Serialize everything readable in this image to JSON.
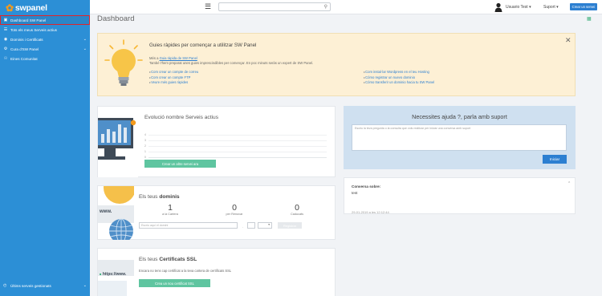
{
  "brand": {
    "name": "swpanel"
  },
  "sidebar": {
    "items": [
      {
        "label": "Dashboard SW Panel",
        "icon": "monitor-icon",
        "active": true,
        "chevron": false
      },
      {
        "label": "Tots els meus Serveis actius",
        "icon": "list-icon",
        "active": false,
        "chevron": false
      },
      {
        "label": "Dominis i Certificats",
        "icon": "globe-icon",
        "active": false,
        "chevron": true
      },
      {
        "label": "Cura d'SW Panel",
        "icon": "gear-icon",
        "active": false,
        "chevron": true
      },
      {
        "label": "Eines Comunitat",
        "icon": "users-icon",
        "active": false,
        "chevron": false
      }
    ],
    "footer_label": "Últims serveis gestionats"
  },
  "topbar": {
    "menu_icon": "hamburger-icon",
    "search_placeholder": "",
    "user_label": "Usuario Test",
    "support_label": "Suport",
    "new_button": "Crear un servei"
  },
  "page": {
    "title": "Dashboard"
  },
  "guide": {
    "title": "Guies ràpides per començar a utilitzar SW Panel",
    "line1_prefix": "Més a",
    "line1_link": "Guia ràpida de SW Panel",
    "line2": "També t'hem preparat unes guies imprescindibles per començar. En poc minuts seràs un expert de SW Panel.",
    "links_left": [
      "Com crear un compte de correu",
      "Com crear un compte FTP",
      "Veure més guies ràpides"
    ],
    "links_right": [
      "Com instal·lar Wordpress en el teu Hosting",
      "Cómo registrar un nuevo dominio",
      "Cómo transferir un dominio hacia tu SW Panel"
    ]
  },
  "services": {
    "title": "Evolució nombre Serveis actius",
    "chart_ticks": [
      "4",
      "3",
      "2",
      "1",
      "0"
    ],
    "button": "Crear un altre servei ara"
  },
  "help": {
    "title": "Necessites ajuda ?, parla amb suport",
    "placeholder": "Escriu la teva pregunta o la consulta que vols realitzar per iniciar una conversa amb suport",
    "button": "Iniciar"
  },
  "conversation": {
    "label": "Conversa sobre:",
    "value": "test",
    "date": "29-01-2019 a les 12:12:44"
  },
  "domains": {
    "title_prefix": "Els teus",
    "title_bold": "dominis",
    "stats": [
      {
        "value": "1",
        "label": "a la Cartera"
      },
      {
        "value": "0",
        "label": "per Renovar"
      },
      {
        "value": "0",
        "label": "Caducats"
      }
    ],
    "input_placeholder": "Escriu aquí el domini",
    "separator": ".",
    "select_value": "▾",
    "button": "Registrar",
    "illustration_text": "www."
  },
  "certs": {
    "title_prefix": "Els teus",
    "title_bold": "Certificats SSL",
    "text": "Encara no tens cap certificat a la teva cartera de certificats SSL",
    "button": "Crea un nou certificat SSL",
    "illustration_text": "https://www."
  },
  "colors": {
    "sidebar": "#2c8fd6",
    "accent": "#2c7fd1",
    "green": "#5fc5a0",
    "guide_bg": "#fdf0d5",
    "help_bg": "#cfe0f0",
    "active_outline": "#e0242a"
  }
}
